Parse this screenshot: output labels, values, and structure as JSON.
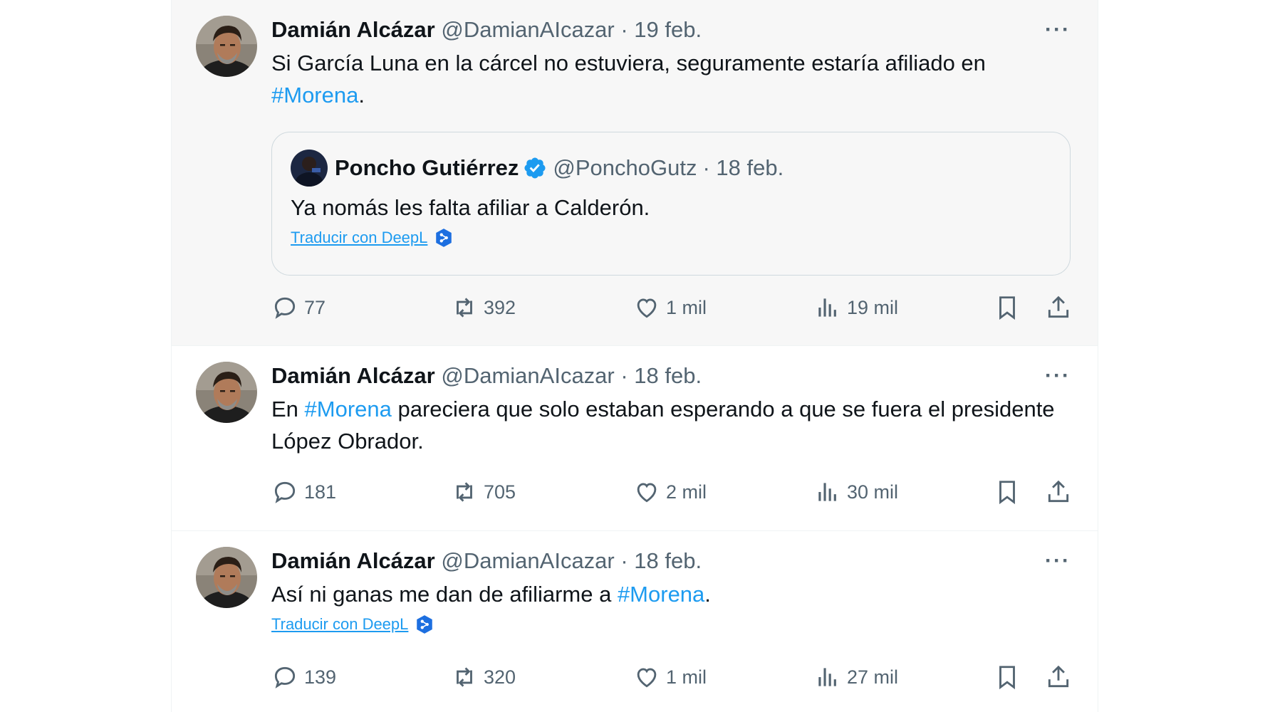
{
  "tweets": [
    {
      "name": "Damián Alcázar",
      "handle": "@DamianAIcazar",
      "date": "· 19 feb.",
      "more": "···",
      "text_before": "Si García Luna en la cárcel no estuviera, seguramente estaría afiliado en ",
      "hashtag": "#Morena",
      "text_after": ".",
      "quote": {
        "name": "Poncho Gutiérrez",
        "handle": "@PonchoGutz",
        "date": "· 18 feb.",
        "text": "Ya nomás les falta afiliar a Calderón.",
        "translate": "Traducir con DeepL"
      },
      "stats": {
        "replies": "77",
        "retweets": "392",
        "likes": "1 mil",
        "views": "19 mil"
      }
    },
    {
      "name": "Damián Alcázar",
      "handle": "@DamianAIcazar",
      "date": "· 18 feb.",
      "more": "···",
      "text_before": "En ",
      "hashtag": "#Morena",
      "text_after": " pareciera que solo estaban esperando a que se fuera el presidente López Obrador.",
      "stats": {
        "replies": "181",
        "retweets": "705",
        "likes": "2 mil",
        "views": "30 mil"
      }
    },
    {
      "name": "Damián Alcázar",
      "handle": "@DamianAIcazar",
      "date": "· 18 feb.",
      "more": "···",
      "text_before": "Así ni ganas me dan de afiliarme a ",
      "hashtag": "#Morena",
      "text_after": ".",
      "translate": "Traducir con DeepL",
      "stats": {
        "replies": "139",
        "retweets": "320",
        "likes": "1 mil",
        "views": "27 mil"
      }
    }
  ],
  "colors": {
    "link": "#1d9bf0",
    "meta": "#536471",
    "highlight_bg": "#f7f7f7"
  },
  "icons": [
    "reply-icon",
    "retweet-icon",
    "like-icon",
    "views-icon",
    "bookmark-icon",
    "share-icon",
    "verified-badge-icon",
    "deepl-icon"
  ]
}
